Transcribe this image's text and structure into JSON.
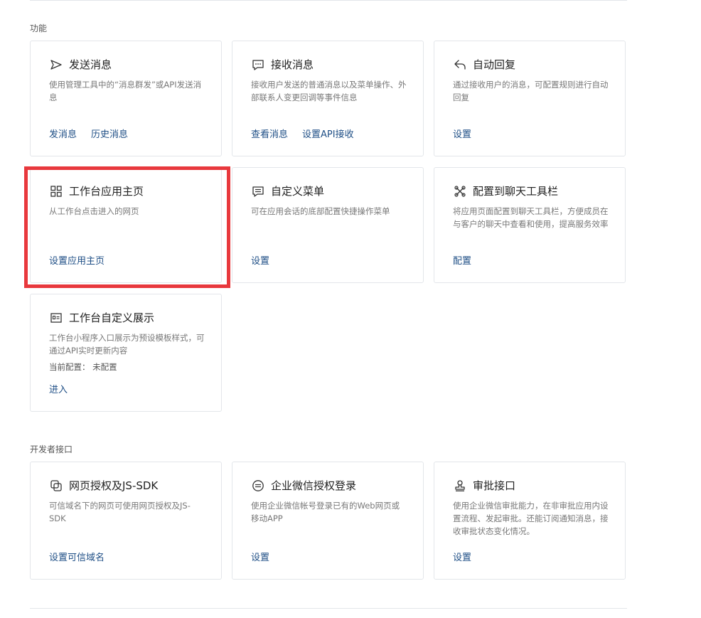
{
  "sections": {
    "features_label": "功能",
    "developer_label": "开发者接口"
  },
  "cards": {
    "send_message": {
      "icon": "send-icon",
      "title": "发送消息",
      "desc": "使用管理工具中的“消息群发”或API发送消息",
      "links": [
        "发消息",
        "历史消息"
      ]
    },
    "receive_message": {
      "icon": "message-icon",
      "title": "接收消息",
      "desc": "接收用户发送的普通消息以及菜单操作、外部联系人变更回调等事件信息",
      "links": [
        "查看消息",
        "设置API接收"
      ]
    },
    "auto_reply": {
      "icon": "reply-icon",
      "title": "自动回复",
      "desc": "通过接收用户的消息，可配置规则进行自动回复",
      "links": [
        "设置"
      ]
    },
    "workbench_home": {
      "icon": "grid-icon",
      "title": "工作台应用主页",
      "desc": "从工作台点击进入的网页",
      "links": [
        "设置应用主页"
      ]
    },
    "custom_menu": {
      "icon": "menu-icon",
      "title": "自定义菜单",
      "desc": "可在应用会话的底部配置快捷操作菜单",
      "links": [
        "设置"
      ]
    },
    "chat_toolbar": {
      "icon": "toolbar-icon",
      "title": "配置到聊天工具栏",
      "desc": "将应用页面配置到聊天工具栏，方便成员在与客户的聊天中查看和使用，提高服务效率",
      "links": [
        "配置"
      ]
    },
    "workbench_display": {
      "icon": "display-icon",
      "title": "工作台自定义展示",
      "desc": "工作台小程序入口展示为预设模板样式，可通过API实时更新内容",
      "extra": "当前配置： 未配置",
      "links": [
        "进入"
      ]
    },
    "web_auth": {
      "icon": "copy-icon",
      "title": "网页授权及JS-SDK",
      "desc": "可信域名下的网页可使用网页授权及JS-SDK",
      "links": [
        "设置可信域名"
      ]
    },
    "wecom_login": {
      "icon": "login-icon",
      "title": "企业微信授权登录",
      "desc": "使用企业微信帐号登录已有的Web网页或移动APP",
      "links": [
        "设置"
      ]
    },
    "approval_api": {
      "icon": "stamp-icon",
      "title": "审批接口",
      "desc": "使用企业微信审批能力，在非审批应用内设置流程、发起审批。还能订阅通知消息，接收审批状态变化情况。",
      "links": [
        "设置"
      ]
    }
  },
  "colors": {
    "link": "#1f4f86",
    "highlight_border": "#e8383d",
    "card_border": "#e3e6ea"
  }
}
